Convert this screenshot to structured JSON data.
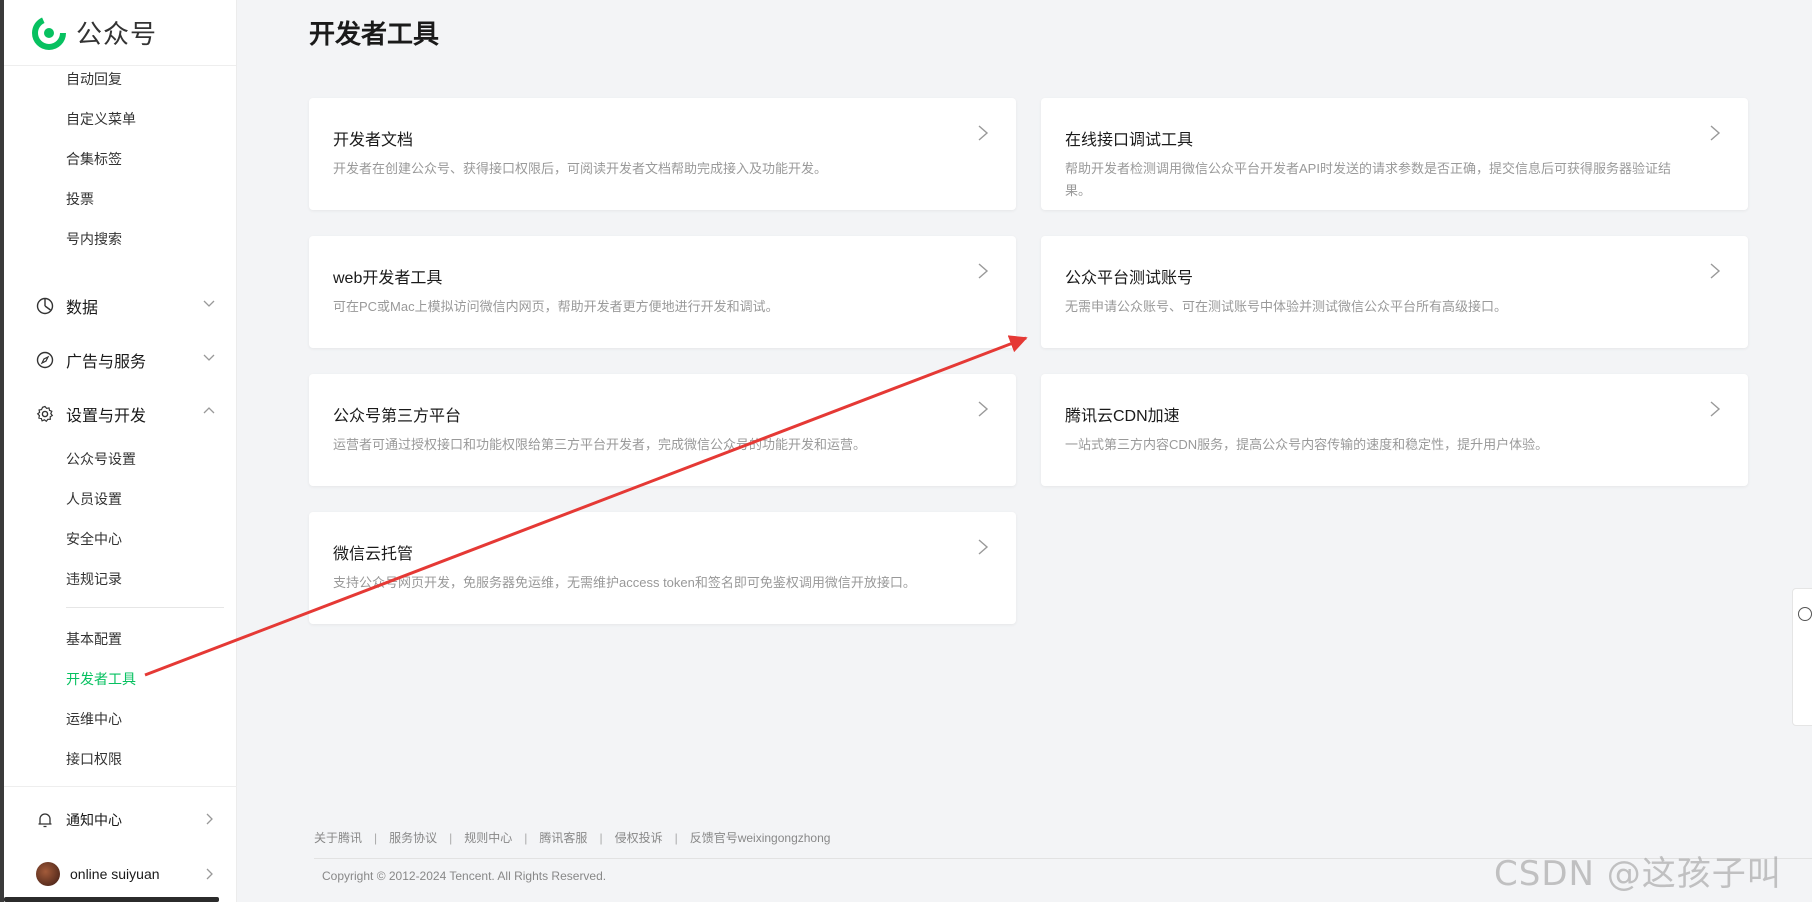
{
  "brand": {
    "name": "公众号"
  },
  "page_title": "开发者工具",
  "sidebar": {
    "top_items": [
      "自动回复",
      "自定义菜单",
      "合集标签",
      "投票",
      "号内搜索"
    ],
    "groups": {
      "data": "数据",
      "ads": "广告与服务",
      "settings": "设置与开发"
    },
    "settings_items_1": [
      "公众号设置",
      "人员设置",
      "安全中心",
      "违规记录"
    ],
    "settings_items_2": [
      "基本配置",
      "开发者工具",
      "运维中心",
      "接口权限"
    ],
    "active_item": "开发者工具",
    "notification": "通知中心",
    "account": "online suiyuan"
  },
  "cards": [
    {
      "title": "开发者文档",
      "desc": "开发者在创建公众号、获得接口权限后，可阅读开发者文档帮助完成接入及功能开发。"
    },
    {
      "title": "在线接口调试工具",
      "desc": "帮助开发者检测调用微信公众平台开发者API时发送的请求参数是否正确，提交信息后可获得服务器验证结果。"
    },
    {
      "title": "web开发者工具",
      "desc": "可在PC或Mac上模拟访问微信内网页，帮助开发者更方便地进行开发和调试。"
    },
    {
      "title": "公众平台测试账号",
      "desc": "无需申请公众账号、可在测试账号中体验并测试微信公众平台所有高级接口。"
    },
    {
      "title": "公众号第三方平台",
      "desc": "运营者可通过授权接口和功能权限给第三方平台开发者，完成微信公众号的功能开发和运营。"
    },
    {
      "title": "腾讯云CDN加速",
      "desc": "一站式第三方内容CDN服务，提高公众号内容传输的速度和稳定性，提升用户体验。"
    },
    {
      "title": "微信云托管",
      "desc": "支持公众号网页开发，免服务器免运维，无需维护access token和签名即可免鉴权调用微信开放接口。"
    }
  ],
  "footer": {
    "links": [
      "关于腾讯",
      "服务协议",
      "规则中心",
      "腾讯客服",
      "侵权投诉",
      "反馈官号weixingongzhong"
    ],
    "copyright": "Copyright © 2012-2024 Tencent. All Rights Reserved."
  },
  "watermark": "CSDN @这孩子叫逆",
  "colors": {
    "accent": "#07c160",
    "annotation_arrow": "#e53935"
  }
}
